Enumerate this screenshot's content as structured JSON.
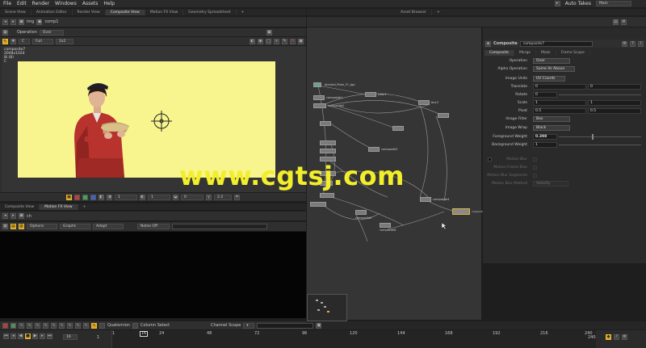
{
  "menu": {
    "items": [
      "File",
      "Edit",
      "Render",
      "Windows",
      "Assets",
      "Help"
    ],
    "auto_takes": "Auto Takes",
    "take": "Main"
  },
  "top_tabs": [
    "Scene View",
    "Animation Editor",
    "Render View",
    "Composite View",
    "Motion FX View",
    "Geometry Spreadsheet"
  ],
  "right_tabs": [
    "Asset Browser"
  ],
  "viewer": {
    "path_img": "img",
    "path_comp": "comp1",
    "operation_label": "Operation",
    "operation_value": "Over",
    "channel": "C",
    "res": "Full",
    "tile": "2x2",
    "info_name": "composite7",
    "info_res": "2048x1024",
    "info_bits": "8i (8)",
    "info_c": "C",
    "zoom_values": [
      "1",
      "1",
      "0",
      "2.2"
    ]
  },
  "motionfx": {
    "tabs": [
      "Composite View",
      "Motion FX View"
    ],
    "path": "ch",
    "options": "Options",
    "graphs": "Graphs",
    "adapt": "Adapt",
    "notes": "Notes Off",
    "quaternion": "Quaternion",
    "column_select": "Column Select"
  },
  "network": {
    "node_read": "blocked_Plate_F1_tga",
    "nodes": [
      "composite1",
      "color1",
      "composite2",
      "blur2",
      "composite3",
      "composite4",
      "composite5",
      "composite6",
      "composite7"
    ],
    "selected": "composite7"
  },
  "params": {
    "type": "Composite",
    "name": "composite7",
    "tabs": [
      "Composite",
      "Merge",
      "Mask",
      "Frame Scope"
    ],
    "rows": [
      {
        "label": "Operation",
        "value": "Over"
      },
      {
        "label": "Alpha Operation",
        "value": "Same As Above"
      },
      {
        "label": "Image Units",
        "value": "UV Coords"
      },
      {
        "label": "Translate",
        "v1": "0",
        "v2": "0"
      },
      {
        "label": "Rotate",
        "v1": "0"
      },
      {
        "label": "Scale",
        "v1": "1",
        "v2": "1"
      },
      {
        "label": "Pivot",
        "v1": "0.5",
        "v2": "0.5"
      },
      {
        "label": "Image Filter",
        "value": "Box"
      },
      {
        "label": "Image Wrap",
        "value": "Black"
      },
      {
        "label": "Foreground Weight",
        "v1": "0.398"
      },
      {
        "label": "Background Weight",
        "v1": "1"
      }
    ],
    "motion": [
      {
        "label": "Motion Blur"
      },
      {
        "label": "Motion Frame Bias"
      },
      {
        "label": "Motion Blur Segments"
      },
      {
        "label": "Motion Blur Method",
        "value": "Velocity"
      }
    ]
  },
  "scope": {
    "label": "Channel Scope"
  },
  "timeline": {
    "frame": "16",
    "start": "1",
    "end": "240",
    "step": "1",
    "ticks": [
      "1",
      "24",
      "48",
      "72",
      "96",
      "120",
      "144",
      "168",
      "192",
      "216",
      "240"
    ]
  },
  "watermark": "www.cgtsj.com",
  "colors": {
    "viewer_bg": "#f8f58e",
    "accent": "#d9a21c",
    "panel": "#2a2a2a",
    "watermark": "#f2ee2a"
  }
}
